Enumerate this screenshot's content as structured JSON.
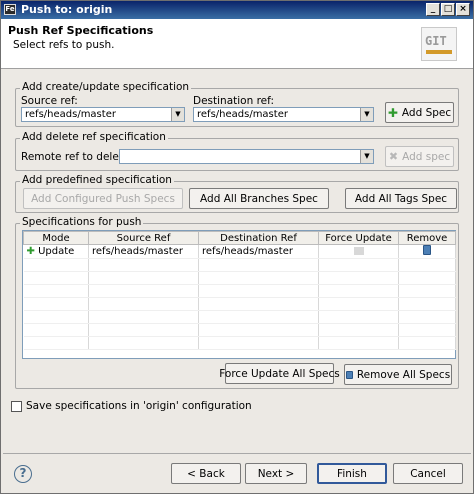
{
  "window": {
    "app_icon": "Fe",
    "title": "Push to: origin",
    "controls": [
      "minimize",
      "maximize",
      "close"
    ]
  },
  "header": {
    "title": "Push Ref Specifications",
    "subtitle": "Select refs to push.",
    "logo_text": "GIT"
  },
  "create_update": {
    "legend": "Add create/update specification",
    "source_label": "Source ref:",
    "source_value": "refs/heads/master",
    "dest_label": "Destination ref:",
    "dest_value": "refs/heads/master",
    "add_button": "Add Spec"
  },
  "delete_ref": {
    "legend": "Add delete ref specification",
    "remote_label": "Remote ref to delete:",
    "remote_value": "",
    "add_button": "Add spec"
  },
  "predefined": {
    "legend": "Add predefined specification",
    "configured_button": "Add Configured Push Specs",
    "branches_button": "Add All Branches Spec",
    "tags_button": "Add All Tags Spec"
  },
  "specs": {
    "legend": "Specifications for push",
    "columns": [
      "Mode",
      "Source Ref",
      "Destination Ref",
      "Force Update",
      "Remove"
    ],
    "rows": [
      {
        "mode": "Update",
        "source": "refs/heads/master",
        "dest": "refs/heads/master"
      }
    ],
    "force_all_button": "Force Update All Specs",
    "remove_all_button": "Remove All Specs"
  },
  "save_config": {
    "label": "Save specifications in 'origin' configuration",
    "checked": false
  },
  "footer": {
    "back": "< Back",
    "next": "Next >",
    "finish": "Finish",
    "cancel": "Cancel",
    "help": "?"
  },
  "colors": {
    "titlebar": "#0a246a",
    "dialog_bg": "#ece9e4",
    "plus_icon": "#2f9b2f"
  }
}
